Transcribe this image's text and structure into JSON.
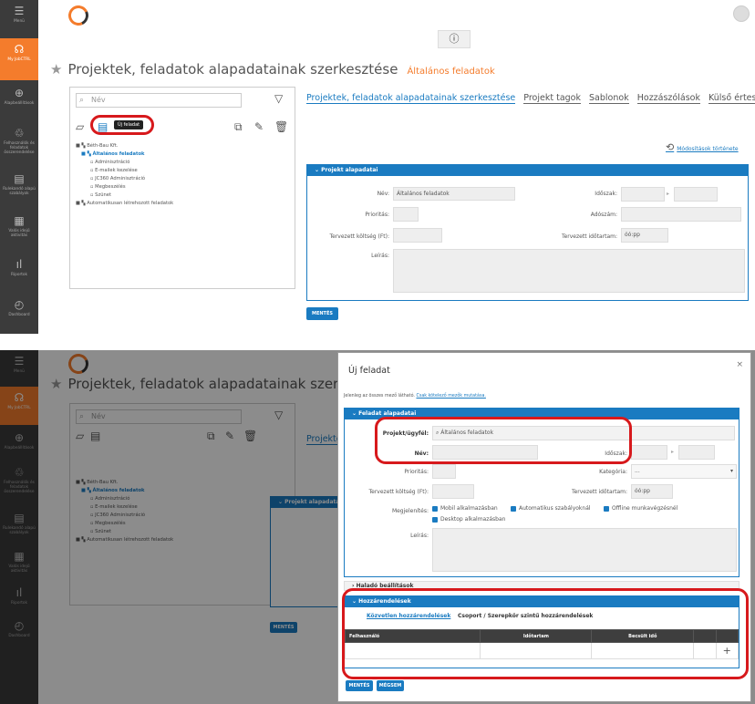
{
  "app": {
    "info_icon": "ⓘ"
  },
  "sidebar": {
    "items": [
      {
        "label": "Menü",
        "icon": "☰"
      },
      {
        "label": "My JobCTRL",
        "icon": "☊"
      },
      {
        "label": "Alapbeállítások",
        "icon": "⊕"
      },
      {
        "label": "Felhasználók és feladatok összerendelése",
        "icon": "♲"
      },
      {
        "label": "Rulekandó alapú szabályok",
        "icon": "▤"
      },
      {
        "label": "Valós idejű aktivitás",
        "icon": "▦"
      },
      {
        "label": "Riportok",
        "icon": "ıl"
      },
      {
        "label": "Dashboard",
        "icon": "◴"
      }
    ]
  },
  "page": {
    "title": "Projektek, feladatok alapadatainak szerkesztése",
    "subtitle": "Általános feladatok"
  },
  "tree_panel": {
    "search_placeholder": "Név",
    "tooltip": "Új feladat",
    "nodes": [
      "Béth-Bau Kft.",
      "Általános feladatok",
      "Adminisztráció",
      "E-mailek kezelése",
      "JC360 Adminisztráció",
      "Megbeszélés",
      "Szünet",
      "Automatikusan létrehozott feladatok"
    ]
  },
  "tabs": [
    "Projektek, feladatok alapadatainak szerkesztése",
    "Projekt tagok",
    "Sablonok",
    "Hozzászólások",
    "Külső értesítések"
  ],
  "history_link": "Módosítások története",
  "project_form": {
    "header": "Projekt alapadatai",
    "name_label": "Név:",
    "name_value": "Általános feladatok",
    "priority_label": "Prioritás:",
    "cost_label": "Tervezett költség (Ft):",
    "description_label": "Leírás:",
    "period_label": "Időszak:",
    "tax_label": "Adószám:",
    "duration_label": "Tervezett időtartam:",
    "duration_placeholder": "óó:pp",
    "save": "MENTÉS"
  },
  "modal": {
    "title": "Új feladat",
    "note_text": "Jelenleg az összes mező látható.",
    "note_link": "Csak kötelező mezők mutatása.",
    "section_basic": "Feladat alapadatai",
    "project_label": "Projekt/ügyfél:",
    "project_value": "Általános feladatok",
    "name_label": "Név:",
    "period_label": "Időszak:",
    "priority_label": "Prioritás:",
    "category_label": "Kategória:",
    "category_value": "...",
    "cost_label": "Tervezett költség (Ft):",
    "duration_label": "Tervezett időtartam:",
    "duration_placeholder": "óó:pp",
    "display_label": "Megjelenítés:",
    "checks": [
      "Mobil alkalmazásban",
      "Automatikus szabályoknál",
      "Offline munkavégzésnél",
      "Desktop alkalmazásban"
    ],
    "description_label": "Leírás:",
    "section_advanced": "Haladó beállítások",
    "section_assign": "Hozzárendelések",
    "assign_tabs": [
      "Közvetlen hozzárendelések",
      "Csoport / Szerepkör szintű hozzárendelések"
    ],
    "columns": [
      "Felhasználó",
      "Időtartam",
      "Becsült idő"
    ],
    "save": "MENTÉS",
    "cancel": "MÉGSEM"
  }
}
